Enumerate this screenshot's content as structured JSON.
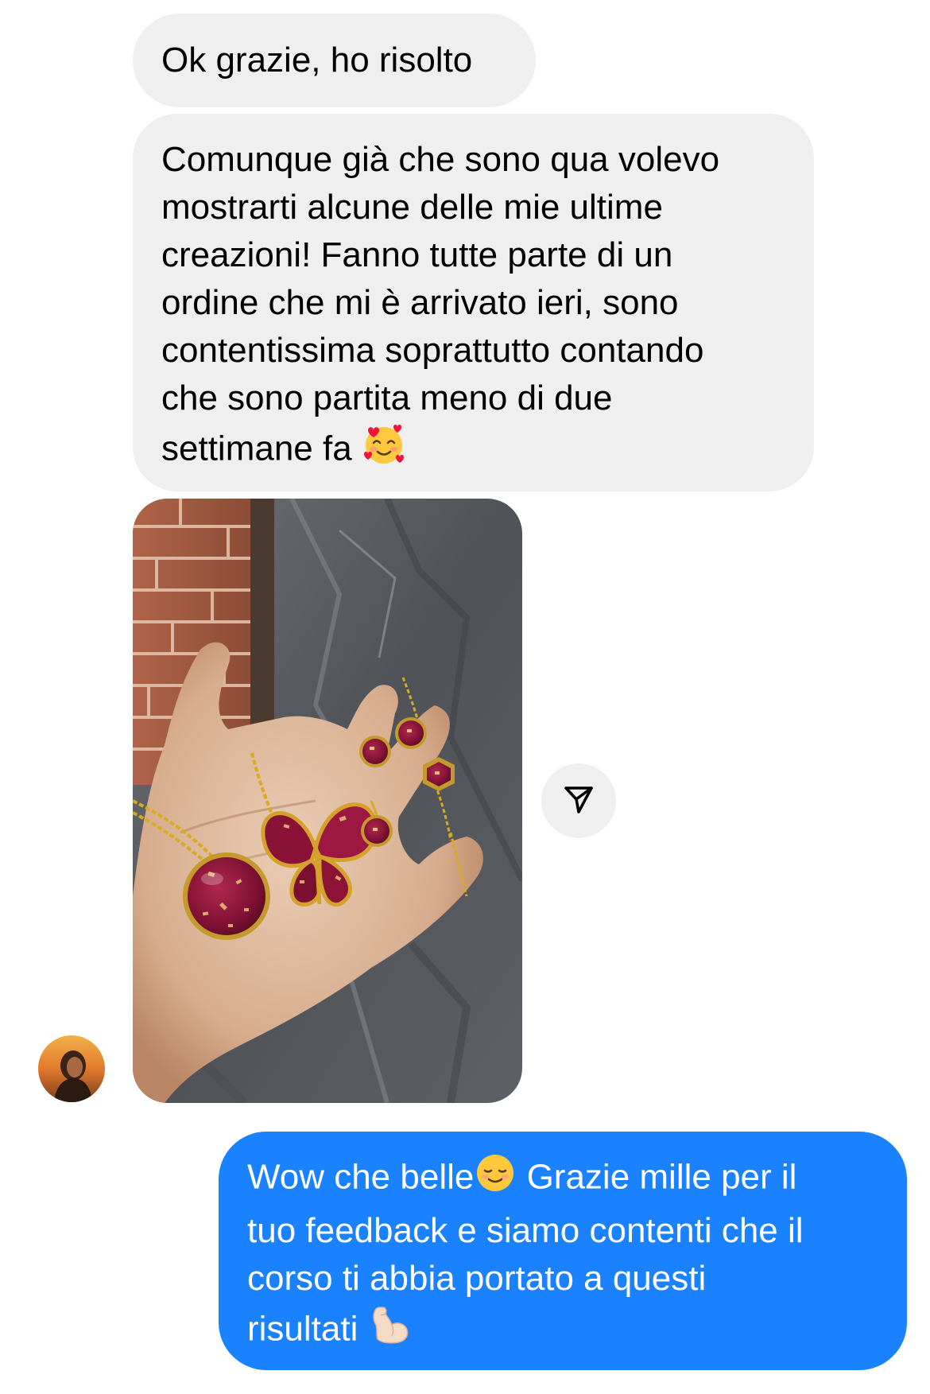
{
  "conversation": {
    "messages": [
      {
        "sender": "them",
        "type": "text",
        "lines": [
          "Ok grazie, ho risolto"
        ]
      },
      {
        "sender": "them",
        "type": "text",
        "lines": [
          "Comunque già che sono qua volevo",
          "mostrarti alcune delle mie ultime",
          "creazioni! Fanno tutte parte di un",
          "ordine che mi è arrivato ieri, sono",
          "contentissima soprattutto contando",
          "che sono partita meno di due",
          "settimane fa"
        ],
        "emoji": "smiling-face-with-hearts"
      },
      {
        "sender": "them",
        "type": "photo",
        "subject": "hand-holding-resin-jewelry"
      },
      {
        "sender": "me",
        "type": "text",
        "lines": [
          "Wow che belle",
          "Grazie mille per il",
          "tuo feedback e siamo contenti che il",
          "corso ti abbia portato a questi",
          "risultati"
        ],
        "emojis": [
          "smiling-face",
          "flexed-biceps"
        ]
      }
    ]
  },
  "colors": {
    "incoming_bubble": "#efefef",
    "outgoing_bubble": "#1a82ff",
    "outgoing_text": "#ffffff",
    "incoming_text": "#000000"
  },
  "icons": {
    "share": "paper-plane-icon",
    "avatar": "contact-avatar"
  }
}
